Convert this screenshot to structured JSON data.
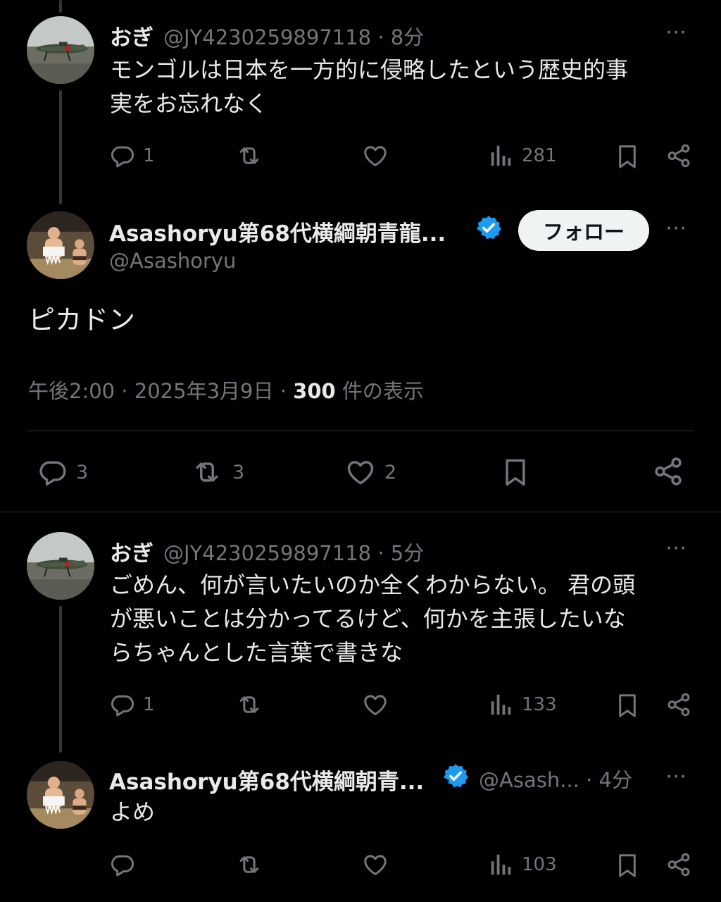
{
  "reply1": {
    "name": "おぎ",
    "handle": "@JY4230259897118",
    "time": "8分",
    "text_line1": "モンゴルは日本を一方的に侵略したという歴史的事",
    "text_line2": "実をお忘れなく",
    "replies": "1",
    "views": "281"
  },
  "main": {
    "name": "Asashoryu第68代横綱朝青龍...",
    "handle": "@Asashoryu",
    "follow_label": "フォロー",
    "text": "ピカドン",
    "time": "午後2:00",
    "date": "2025年3月9日",
    "views_count": "300",
    "views_label": "件の表示",
    "replies": "3",
    "retweets": "3",
    "likes": "2"
  },
  "reply2": {
    "name": "おぎ",
    "handle": "@JY4230259897118",
    "time": "5分",
    "text_line1": "ごめん、何が言いたいのか全くわからない。 君の頭",
    "text_line2": "が悪いことは分かってるけど、何かを主張したいな",
    "text_line3": "らちゃんとした言葉で書きな",
    "replies": "1",
    "views": "133"
  },
  "reply3": {
    "name": "Asashoryu第68代横綱朝青...",
    "handle": "@Asash...",
    "time": "4分",
    "text": "よめ",
    "views": "103"
  },
  "separator": "·",
  "more_icon": "⋯",
  "colors": {
    "verified": "#1d9bf0",
    "muted": "#71767b",
    "text": "#e7e9ea",
    "background": "#000000"
  }
}
